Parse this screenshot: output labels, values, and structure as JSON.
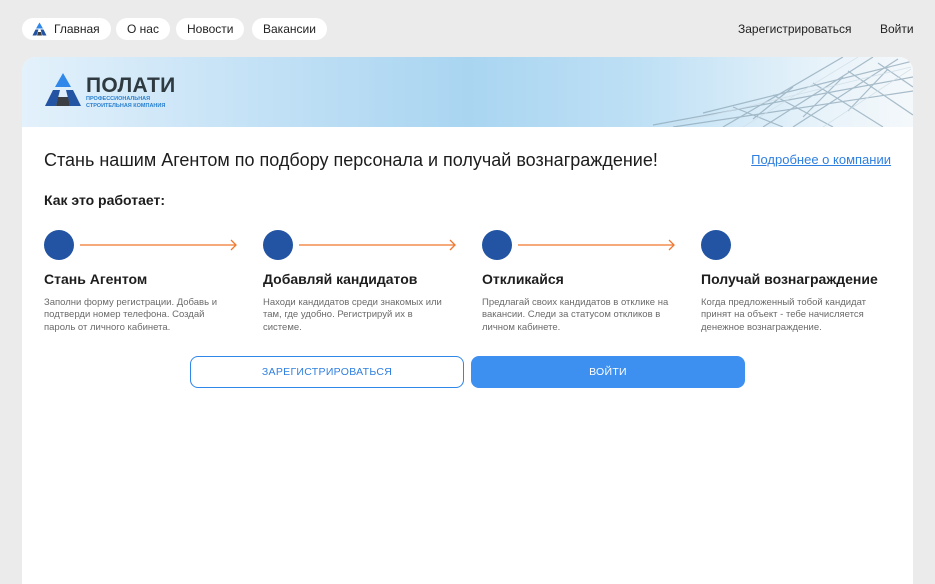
{
  "nav": {
    "home_label": "Главная",
    "about_label": "О нас",
    "news_label": "Новости",
    "jobs_label": "Вакансии",
    "register_label": "Зарегистрироваться",
    "login_label": "Войти"
  },
  "brand": {
    "name": "ПОЛАТИ",
    "tagline": "Профессиональная строительная компания"
  },
  "main": {
    "headline": "Стань нашим Агентом по подбору персонала и получай вознаграждение!",
    "more_link": "Подробнее о компании",
    "how_title": "Как это работает:",
    "steps": [
      {
        "title": "Стань Агентом",
        "description": "Заполни форму регистрации. Добавь и подтверди номер телефона. Создай пароль от личного кабинета."
      },
      {
        "title": "Добавляй кандидатов",
        "description": "Находи кандидатов среди знакомых или там, где удобно. Регистрируй их в системе."
      },
      {
        "title": "Откликайся",
        "description": "Предлагай своих кандидатов в отклике на вакансии. Следи за статусом откликов в личном кабинете."
      },
      {
        "title": "Получай вознаграждение",
        "description": "Когда предложенный тобой кандидат принят на объект - тебе начисляется денежное вознаграждение."
      }
    ],
    "register_button": "Зарегистрироваться",
    "login_button": "Войти"
  },
  "colors": {
    "accent": "#3d8ff0",
    "step_dot": "#2254a3",
    "arrow": "#f0772d",
    "background": "#ebebeb"
  }
}
